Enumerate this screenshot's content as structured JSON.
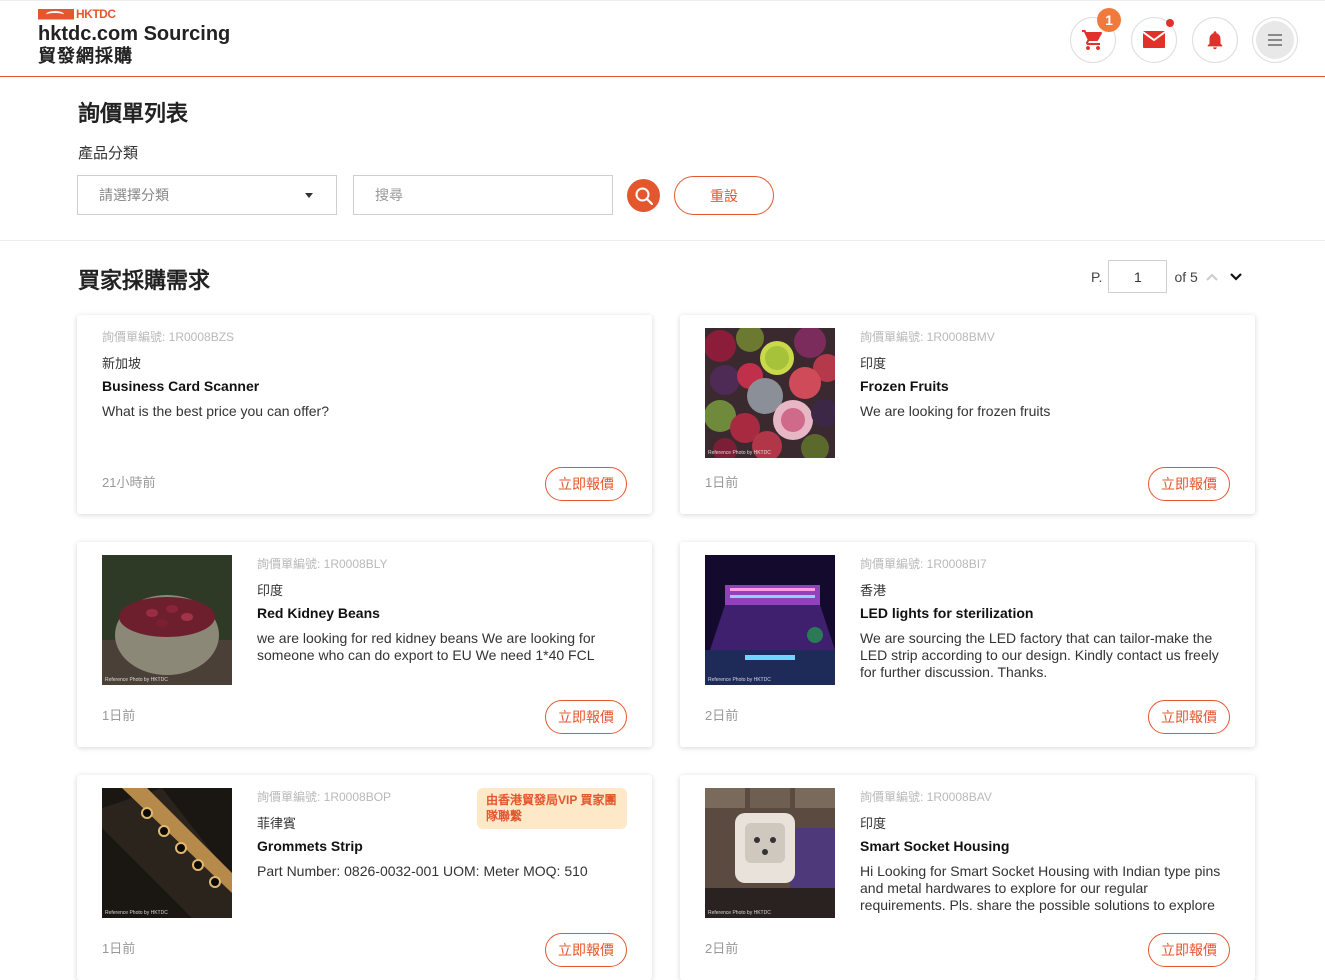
{
  "header": {
    "logo_mark": "HKTDC",
    "logo_title": "hktdc.com Sourcing",
    "logo_subtitle": "貿發網採購",
    "cart_count": "1",
    "accent": "#e4572e"
  },
  "filters": {
    "page_title": "詢價單列表",
    "category_label": "產品分類",
    "category_placeholder": "請選擇分類",
    "search_placeholder": "搜尋",
    "reset_label": "重設"
  },
  "section": {
    "title": "買家採購需求",
    "page_prefix": "P.",
    "page_value": "1",
    "page_total": "of 5"
  },
  "cards": [
    {
      "ref": "詢價單編號: 1R0008BZS",
      "country": "新加坡",
      "title": "Business Card Scanner",
      "desc": "What is the best price you can offer?",
      "time": "21小時前",
      "button": "立即報價",
      "image": ""
    },
    {
      "ref": "詢價單編號: 1R0008BMV",
      "country": "印度",
      "title": "Frozen Fruits",
      "desc": "We are looking for frozen fruits",
      "time": "1日前",
      "button": "立即報價",
      "image": "frozen-fruits-photo",
      "caption": "Reference Photo by HKTDC"
    },
    {
      "ref": "詢價單編號: 1R0008BLY",
      "country": "印度",
      "title": "Red Kidney Beans",
      "desc": "we are looking for red kidney beans We are looking for someone who can do export to EU We need 1*40 FCL",
      "time": "1日前",
      "button": "立即報價",
      "image": "kidney-beans-photo",
      "caption": "Reference Photo by HKTDC"
    },
    {
      "ref": "詢價單編號: 1R0008BI7",
      "country": "香港",
      "title": "LED lights for sterilization",
      "desc": "We are sourcing the LED factory that can tailor-make the LED strip according to our design. Kindly contact us freely for further discussion. Thanks.",
      "time": "2日前",
      "button": "立即報價",
      "image": "led-lights-photo",
      "caption": "Reference Photo by HKTDC"
    },
    {
      "ref": "詢價單編號: 1R0008BOP",
      "country": "菲律賓",
      "title": "Grommets Strip",
      "desc": "Part Number: 0826-0032-001 UOM: Meter MOQ: 510",
      "time": "1日前",
      "button": "立即報價",
      "image": "grommets-strip-photo",
      "caption": "Reference Photo by HKTDC",
      "vip": "由香港貿發局VIP 買家團隊聯繫"
    },
    {
      "ref": "詢價單編號: 1R0008BAV",
      "country": "印度",
      "title": "Smart Socket Housing",
      "desc": "Hi Looking for Smart Socket Housing with Indian type pins and metal hardwares to explore for our regular requirements. Pls. share the possible solutions to explore together.",
      "time": "2日前",
      "button": "立即報價",
      "image": "smart-socket-photo",
      "caption": "Reference Photo by HKTDC"
    }
  ]
}
